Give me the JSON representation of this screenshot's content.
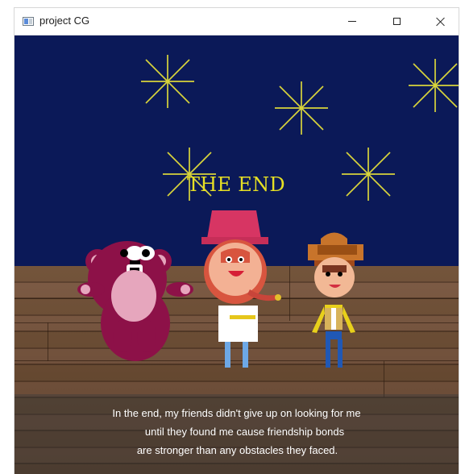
{
  "window": {
    "title": "project CG",
    "controls": {
      "minimize": "—",
      "maximize": "□",
      "close": "✕"
    }
  },
  "scene": {
    "heading": "THE END",
    "caption_lines": [
      "In the end, my friends didn't give up on looking for me",
      "until they found me cause friendship bonds",
      "are stronger than any obstacles they faced."
    ]
  },
  "colors": {
    "sky": "#0b1958",
    "title_text": "#e6df24",
    "stars": "#d8d43b",
    "wood": "#6b4a2f",
    "bear": "#8d1148",
    "hat_pink": "#d73563",
    "cowboy_hat": "#c8742b"
  }
}
